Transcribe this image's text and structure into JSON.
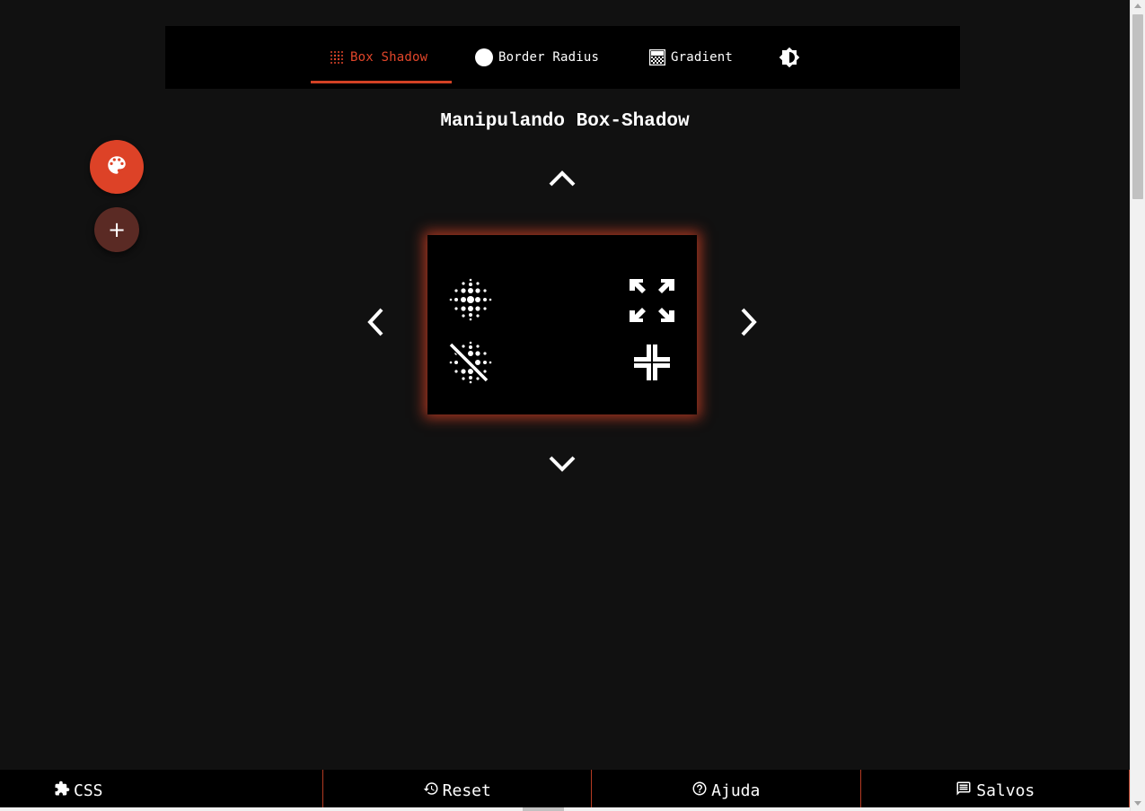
{
  "nav": {
    "tabs": [
      {
        "label": "Box Shadow",
        "icon": "dots-grid-icon",
        "active": true
      },
      {
        "label": "Border Radius",
        "icon": "circle-icon",
        "active": false
      },
      {
        "label": "Gradient",
        "icon": "gradient-icon",
        "active": false
      },
      {
        "label": "",
        "icon": "contrast-icon",
        "active": false
      }
    ]
  },
  "main": {
    "title": "Manipulando Box-Shadow"
  },
  "fab": {
    "main_icon": "palette-icon",
    "add_label": "+"
  },
  "preview": {
    "tools": [
      "blur-icon",
      "blur-off-icon",
      "expand-icon",
      "compress-icon"
    ]
  },
  "bottom": {
    "items": [
      {
        "label": "CSS",
        "icon": "puzzle-icon"
      },
      {
        "label": "Reset",
        "icon": "history-icon"
      },
      {
        "label": "Ajuda",
        "icon": "help-icon"
      },
      {
        "label": "Salvos",
        "icon": "saved-icon"
      }
    ]
  },
  "colors": {
    "accent": "#dd4227",
    "background": "#111111",
    "panel": "#000000"
  }
}
